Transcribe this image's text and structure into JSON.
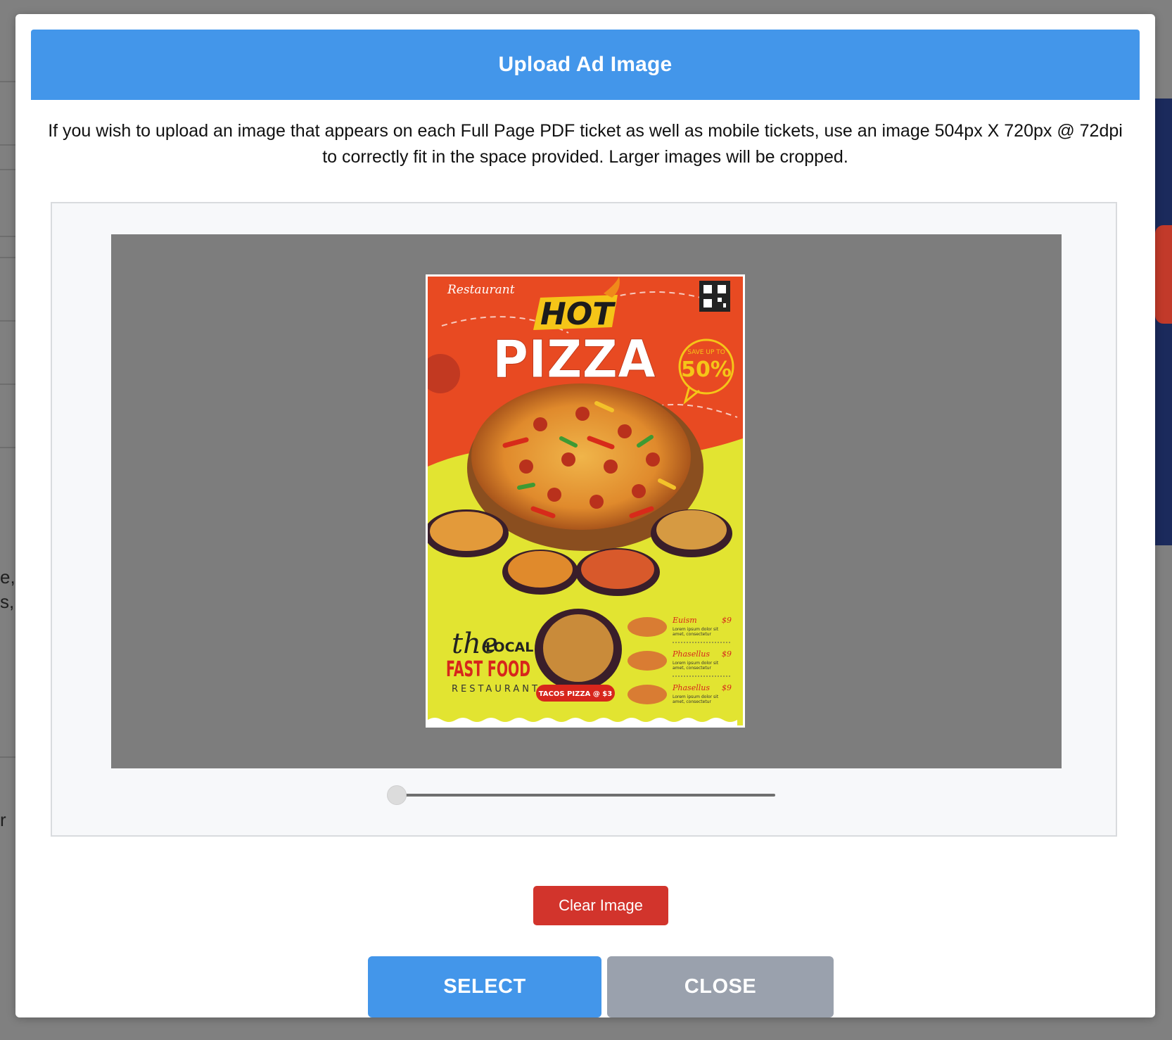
{
  "background": {
    "partial_text_lines": [
      "e,",
      "s, c",
      "r"
    ]
  },
  "modal": {
    "title": "Upload Ad Image",
    "description": "If you wish to upload an image that appears on each Full Page PDF ticket as well as mobile tickets, use an image 504px X 720px @ 72dpi to correctly fit in the space provided. Larger images will be cropped.",
    "zoom_level": 0,
    "preview": {
      "icon": "pizza-flyer-image",
      "script_label": "Restaurant",
      "headline_top": "HOT",
      "headline_main": "PIZZA",
      "badge_small": "SAVE UP TO",
      "badge_big": "50%",
      "brand_the": "the",
      "brand_local": "LOCAL",
      "brand_fast_food": "FAST FOOD",
      "brand_restaurant": "RESTAURANT",
      "tacos_label": "TACOS PIZZA @ $3",
      "menu_items": [
        {
          "name": "Euism",
          "price": "$9",
          "desc_1": "Lorem ipsum dolor sit",
          "desc_2": "amet, consectetur"
        },
        {
          "name": "Phasellus",
          "price": "$9",
          "desc_1": "Lorem ipsum dolor sit",
          "desc_2": "amet, consectetur"
        },
        {
          "name": "Phasellus",
          "price": "$9",
          "desc_1": "Lorem ipsum dolor sit",
          "desc_2": "amet, consectetur"
        }
      ]
    },
    "clear_label": "Clear Image",
    "select_label": "SELECT",
    "close_label": "CLOSE"
  },
  "colors": {
    "header_blue": "#4396ea",
    "clear_red": "#d2342c",
    "close_gray": "#9aa1ad",
    "canvas_gray": "#7d7d7d"
  }
}
